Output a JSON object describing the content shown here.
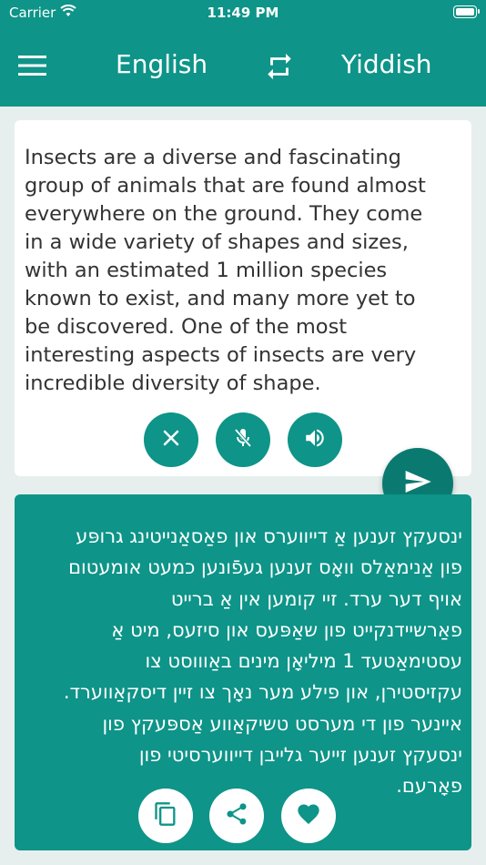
{
  "status": {
    "carrier": "Carrier",
    "time": "11:49 PM"
  },
  "header": {
    "source_language": "English",
    "target_language": "Yiddish",
    "icons": [
      "menu-icon",
      "swap-icon"
    ]
  },
  "input": {
    "text": "Insects are a diverse and fascinating\ngroup of animals that are found almost\neverywhere on the ground. They come\nin a wide variety of shapes and sizes,\nwith an estimated 1 million species\nknown to exist, and many more yet to\nbe discovered. One of the most\ninteresting aspects of insects are very\nincredible diversity of shape.",
    "buttons": [
      "close-icon",
      "mic-off-icon",
      "speaker-icon"
    ]
  },
  "send": {
    "icon": "send-icon"
  },
  "output": {
    "text": "ינסעקץ זענען אַ דייווערס און פאַסאַנייטינג גרופּע\nפון אַנימאַלס וואָס זענען געפֿונען כמעט אומעטום\nאויף דער ערד. זיי קומען אין אַ ברייט\nפאַרשיידנקייט פון שאַפּעס און סיזעס, מיט אַ\nעסטימאַטעד 1 מיליאָן מינים באַוווסט צו\nעקזיסטירן, און פילע מער נאָך צו זיין דיסקאַווערד.\nאיינער פון די מערסט טשיקאַווע אַספּעקץ פון\nינסעקץ זענען זייער גלייבן דייווערסיטי פון\nפאָרעם.",
    "buttons": [
      "copy-icon",
      "share-icon",
      "heart-icon"
    ]
  },
  "colors": {
    "primary": "#0e9488",
    "send": "#0a7a70",
    "background": "#e6efed"
  }
}
